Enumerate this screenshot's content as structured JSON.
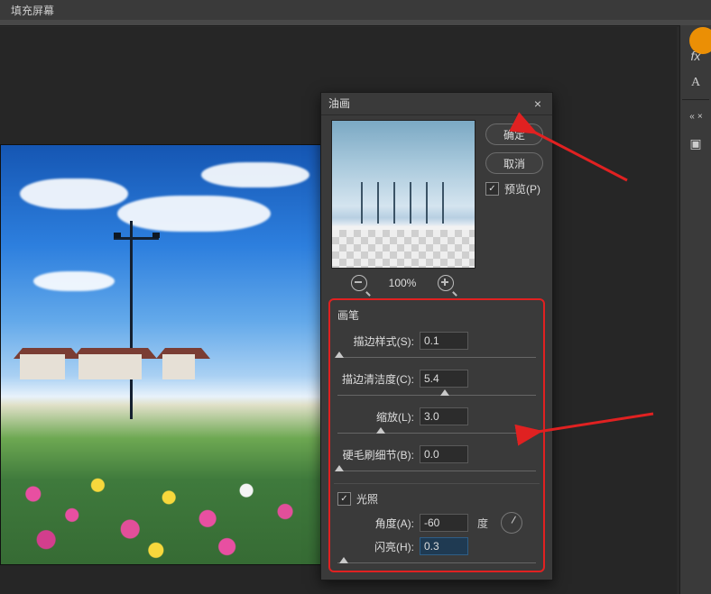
{
  "menubar": {
    "fill_screen": "填充屏幕"
  },
  "rightstrip": {
    "fx_icon": "fx",
    "text_icon": "A",
    "collapse_icon": "«",
    "swatch_icon": "▣"
  },
  "dialog": {
    "title": "油画",
    "ok_label": "确定",
    "cancel_label": "取消",
    "preview_label": "预览(P)",
    "preview_checked": "✓",
    "zoom_pct": "100%",
    "brush": {
      "group_label": "画笔",
      "stroke_style_label": "描边样式(S):",
      "stroke_style_value": "0.1",
      "stroke_clean_label": "描边清洁度(C):",
      "stroke_clean_value": "5.4",
      "scale_label": "缩放(L):",
      "scale_value": "3.0",
      "bristle_label": "硬毛刷细节(B):",
      "bristle_value": "0.0"
    },
    "lighting": {
      "group_label": "光照",
      "checked": "✓",
      "angle_label": "角度(A):",
      "angle_value": "-60",
      "angle_unit": "度",
      "shine_label": "闪亮(H):",
      "shine_value": "0.3"
    }
  }
}
